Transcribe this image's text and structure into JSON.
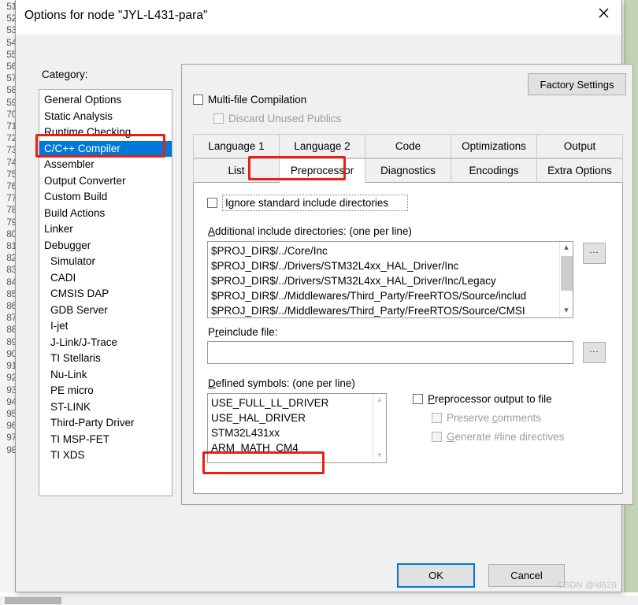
{
  "window": {
    "title": "Options for node \"JYL-L431-para\"",
    "close_icon": "close-icon"
  },
  "background": {
    "line_numbers": [
      "51",
      "52",
      "53",
      "54",
      "55",
      "56",
      "57",
      "58",
      "59",
      "70",
      "71",
      "72",
      "73",
      "74",
      "75",
      "76",
      "77",
      "78",
      "79",
      "80",
      "81",
      "82",
      "83",
      "84",
      "85",
      "86",
      "87",
      "88",
      "89",
      "90",
      "91",
      "92",
      "93",
      "94",
      "95",
      "96",
      "97",
      "98"
    ]
  },
  "category": {
    "label": "Category:",
    "selected": "C/C++ Compiler",
    "items": [
      {
        "label": "General Options",
        "indent": false
      },
      {
        "label": "Static Analysis",
        "indent": false
      },
      {
        "label": "Runtime Checking",
        "indent": false
      },
      {
        "label": "C/C++ Compiler",
        "indent": false
      },
      {
        "label": "Assembler",
        "indent": false
      },
      {
        "label": "Output Converter",
        "indent": false
      },
      {
        "label": "Custom Build",
        "indent": false
      },
      {
        "label": "Build Actions",
        "indent": false
      },
      {
        "label": "Linker",
        "indent": false
      },
      {
        "label": "Debugger",
        "indent": false
      },
      {
        "label": "Simulator",
        "indent": true
      },
      {
        "label": "CADI",
        "indent": true
      },
      {
        "label": "CMSIS DAP",
        "indent": true
      },
      {
        "label": "GDB Server",
        "indent": true
      },
      {
        "label": "I-jet",
        "indent": true
      },
      {
        "label": "J-Link/J-Trace",
        "indent": true
      },
      {
        "label": "TI Stellaris",
        "indent": true
      },
      {
        "label": "Nu-Link",
        "indent": true
      },
      {
        "label": "PE micro",
        "indent": true
      },
      {
        "label": "ST-LINK",
        "indent": true
      },
      {
        "label": "Third-Party Driver",
        "indent": true
      },
      {
        "label": "TI MSP-FET",
        "indent": true
      },
      {
        "label": "TI XDS",
        "indent": true
      }
    ]
  },
  "panel": {
    "factory_settings_label": "Factory Settings",
    "multifile_compilation": {
      "label": "Multi-file Compilation",
      "checked": false,
      "enabled": true
    },
    "discard_unused_publics": {
      "label": "Discard Unused Publics",
      "checked": false,
      "enabled": false
    }
  },
  "tabs": {
    "row1": [
      {
        "label": "Language 1",
        "active": false
      },
      {
        "label": "Language 2",
        "active": false
      },
      {
        "label": "Code",
        "active": false
      },
      {
        "label": "Optimizations",
        "active": false
      },
      {
        "label": "Output",
        "active": false
      }
    ],
    "row2": [
      {
        "label": "List",
        "active": false
      },
      {
        "label": "Preprocessor",
        "active": true
      },
      {
        "label": "Diagnostics",
        "active": false
      },
      {
        "label": "Encodings",
        "active": false
      },
      {
        "label": "Extra Options",
        "active": false
      }
    ]
  },
  "preprocessor": {
    "ignore_standard_includes": {
      "label": "Ignore standard include directories",
      "checked": false
    },
    "additional_include_label": "Additional include directories: (one per line)",
    "include_directories": [
      "$PROJ_DIR$/../Core/Inc",
      "$PROJ_DIR$/../Drivers/STM32L4xx_HAL_Driver/Inc",
      "$PROJ_DIR$/../Drivers/STM32L4xx_HAL_Driver/Inc/Legacy",
      "$PROJ_DIR$/../Middlewares/Third_Party/FreeRTOS/Source/includ",
      "$PROJ_DIR$/../Middlewares/Third_Party/FreeRTOS/Source/CMSI"
    ],
    "preinclude_label": "Preinclude file:",
    "preinclude_value": "",
    "preinclude_placeholder": "",
    "defined_symbols_label": "Defined symbols: (one per line)",
    "defined_symbols": [
      "USE_FULL_LL_DRIVER",
      "USE_HAL_DRIVER",
      "STM32L431xx",
      "ARM_MATH_CM4"
    ],
    "browse_button_label": "...",
    "preprocessor_output_to_file": {
      "label": "Preprocessor output to file",
      "checked": false,
      "enabled": true
    },
    "preserve_comments": {
      "label": "Preserve comments",
      "checked": false,
      "enabled": false
    },
    "generate_line_directives": {
      "label": "Generate #line directives",
      "checked": false,
      "enabled": false
    }
  },
  "footer": {
    "ok_label": "OK",
    "cancel_label": "Cancel",
    "watermark": "CSDN @ld620"
  },
  "colors": {
    "selection_blue": "#0078d7",
    "annotation_red": "#e81f15",
    "dialog_bg": "#f0f0f0"
  }
}
